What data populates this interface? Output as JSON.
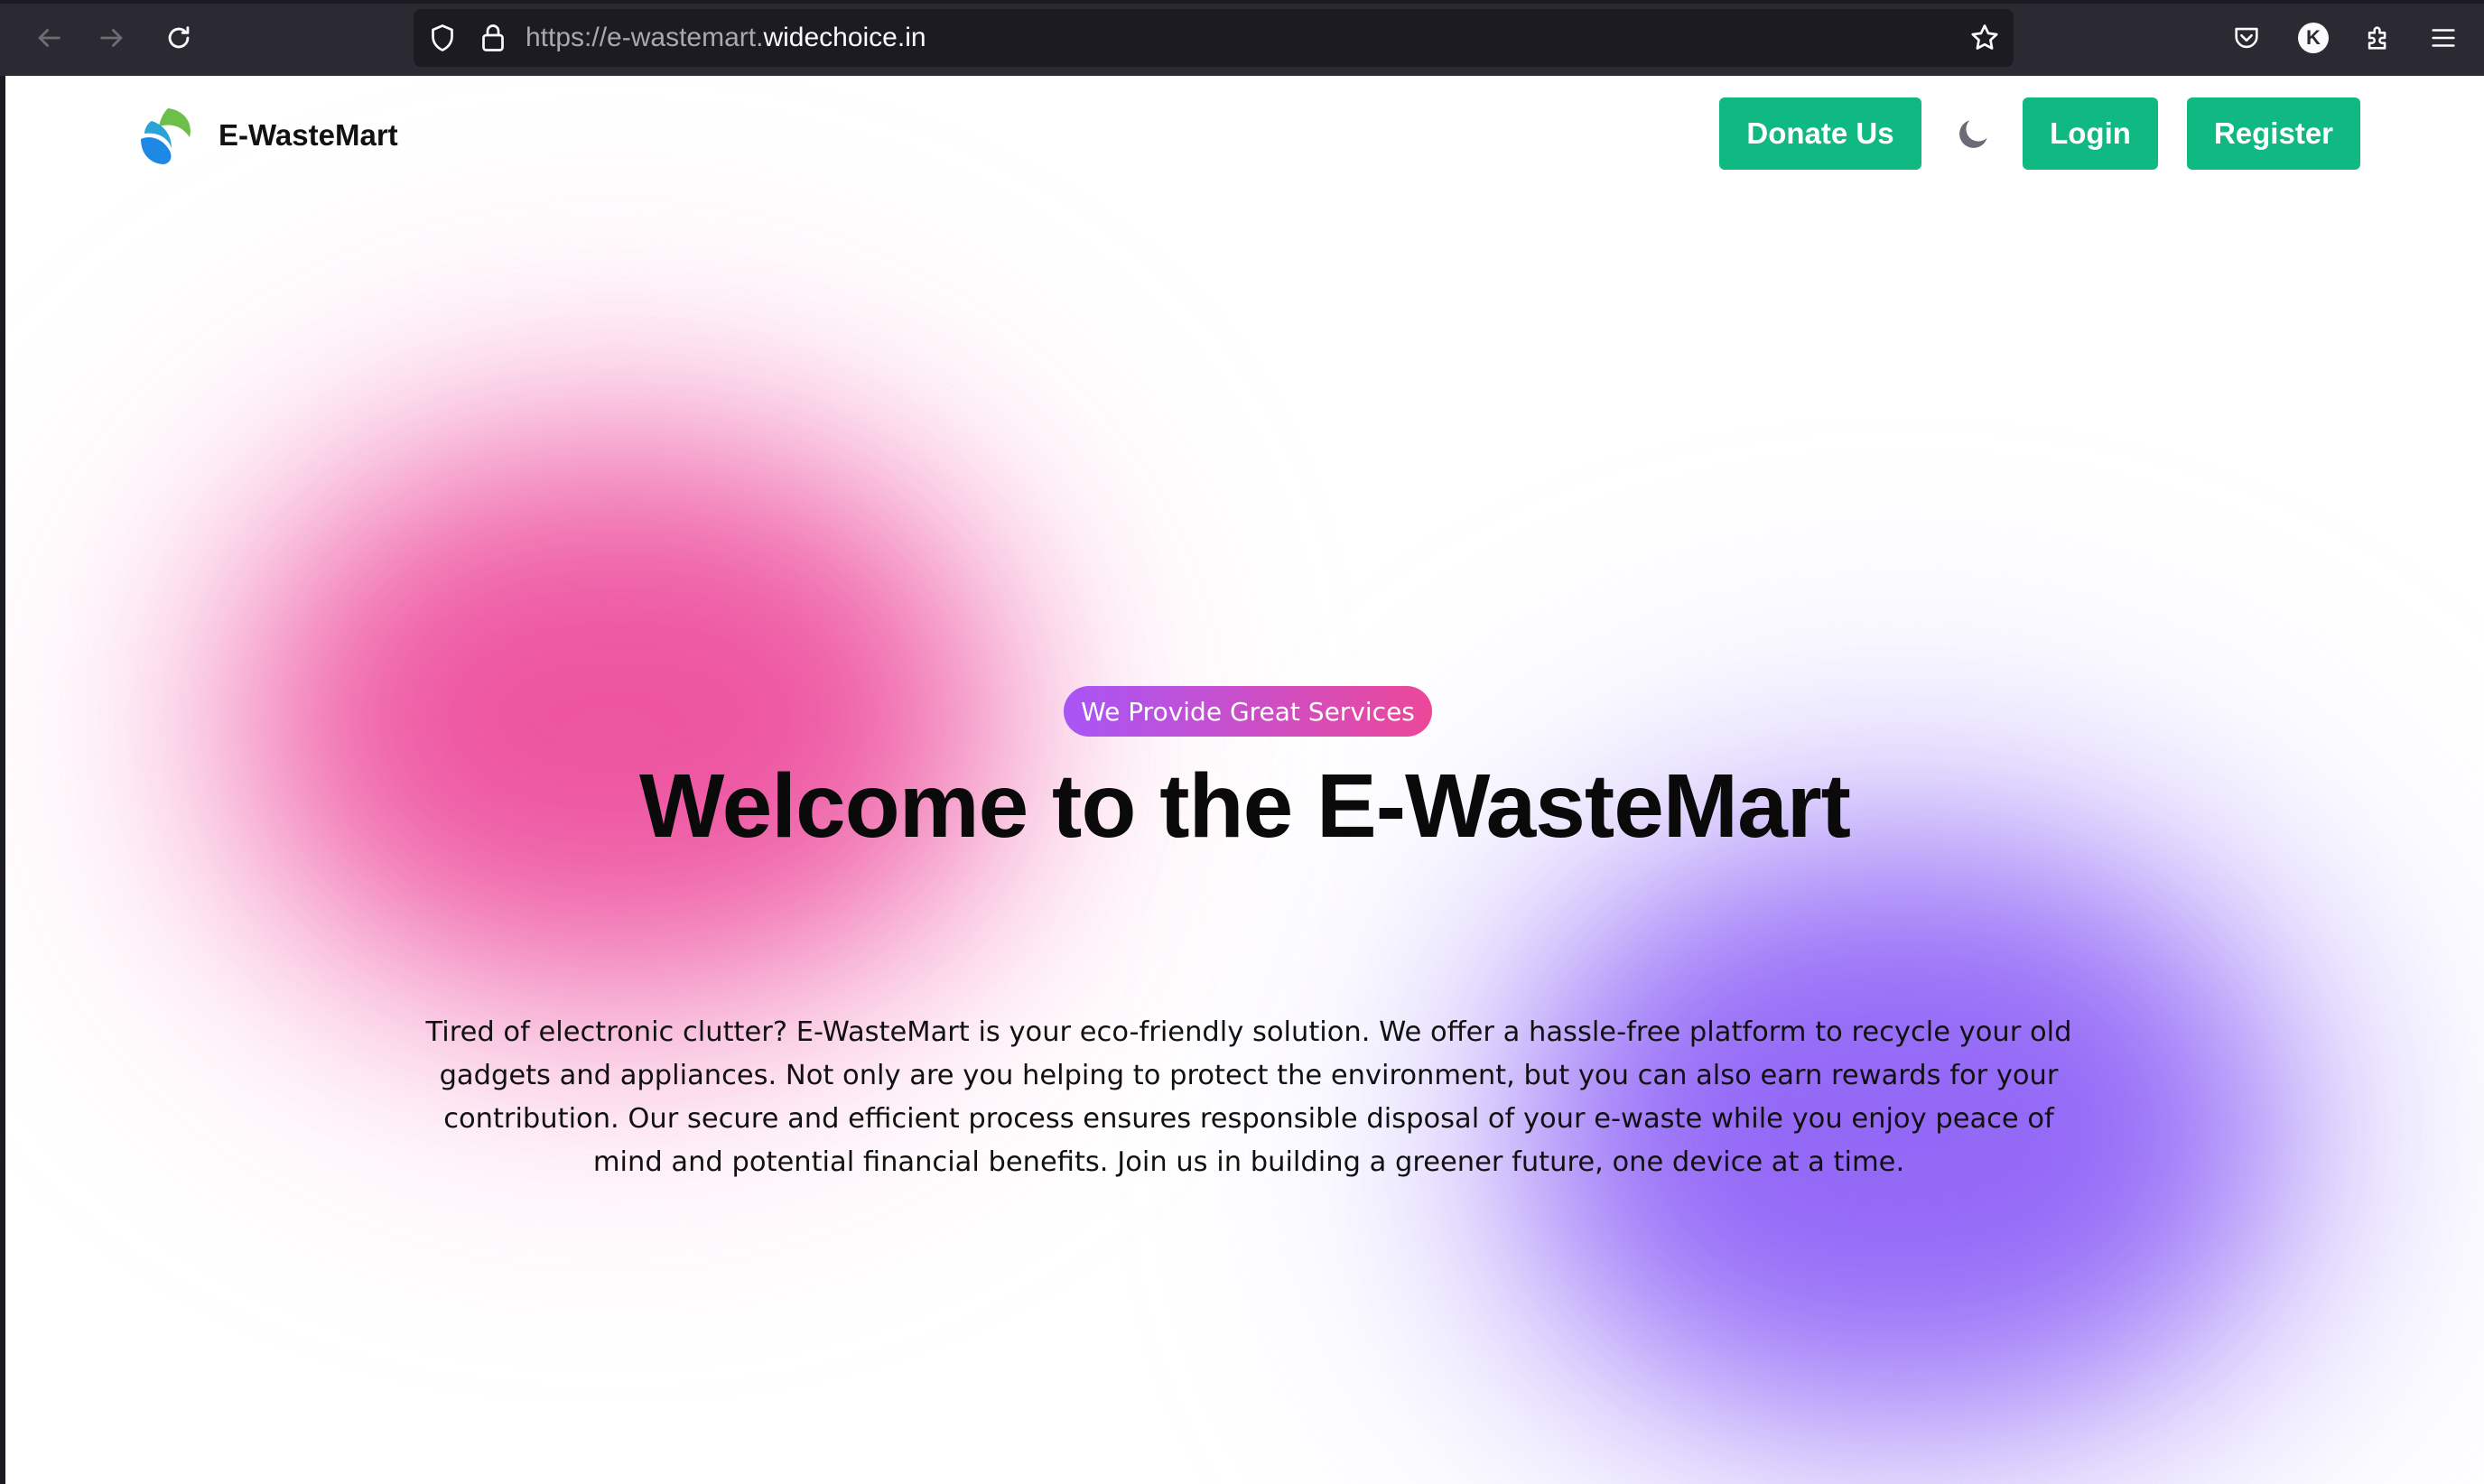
{
  "browser": {
    "url_prefix": "https://e-wastemart.",
    "url_domain": "widechoice.in",
    "profile_initial": "K"
  },
  "header": {
    "brand": "E-WasteMart",
    "donate_label": "Donate Us",
    "login_label": "Login",
    "register_label": "Register"
  },
  "hero": {
    "badge": "We Provide Great Services",
    "title": "Welcome to the E-WasteMart",
    "description": "Tired of electronic clutter? E-WasteMart is your eco-friendly solution. We offer a hassle-free platform to recycle your old gadgets and appliances. Not only are you helping to protect the environment, but you can also earn rewards for your contribution. Our secure and efficient process ensures responsible disposal of your e-waste while you enjoy peace of mind and potential financial benefits. Join us in building a greener future, one device at a time."
  },
  "colors": {
    "accent_green": "#10b981",
    "badge_gradient_start": "#a855f7",
    "badge_gradient_end": "#ec4899",
    "blob_pink": "#ec4899",
    "blob_purple": "#8b5cf6"
  },
  "icons": {
    "back": "back-arrow-icon",
    "forward": "forward-arrow-icon",
    "reload": "reload-icon",
    "shield": "shield-icon",
    "lock": "lock-icon",
    "bookmark": "star-icon",
    "pocket": "pocket-icon",
    "extensions": "puzzle-icon",
    "menu": "hamburger-menu-icon",
    "theme_toggle": "moon-icon",
    "logo": "leaf-logo-icon"
  }
}
